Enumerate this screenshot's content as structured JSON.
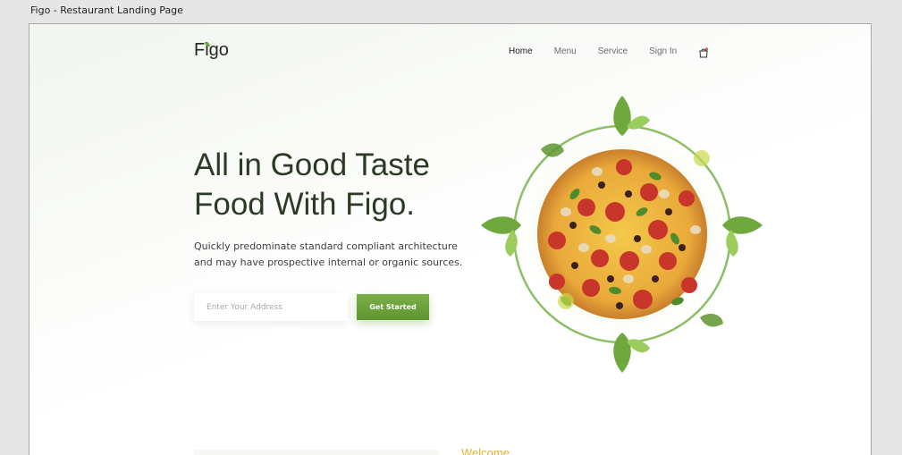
{
  "window": {
    "title": "Figo - Restaurant Landing Page"
  },
  "header": {
    "logo": "Figo",
    "nav": [
      {
        "label": "Home",
        "active": true
      },
      {
        "label": "Menu",
        "active": false
      },
      {
        "label": "Service",
        "active": false
      },
      {
        "label": "Sign In",
        "active": false
      }
    ],
    "cart_icon": "shopping-bag-icon"
  },
  "hero": {
    "title_line1": "All in Good Taste",
    "title_line2": "Food With Figo.",
    "desc_line1": "Quickly predominate standard compliant architecture",
    "desc_line2": "and may have prospective internal or organic sources.",
    "address_placeholder": "Enter Your Address",
    "cta_label": "Get Started"
  },
  "next_section": {
    "heading": "Welcome"
  },
  "colors": {
    "accent_green": "#6ea43c",
    "heading": "#2b3a24",
    "welcome_yellow": "#e2b23c"
  }
}
